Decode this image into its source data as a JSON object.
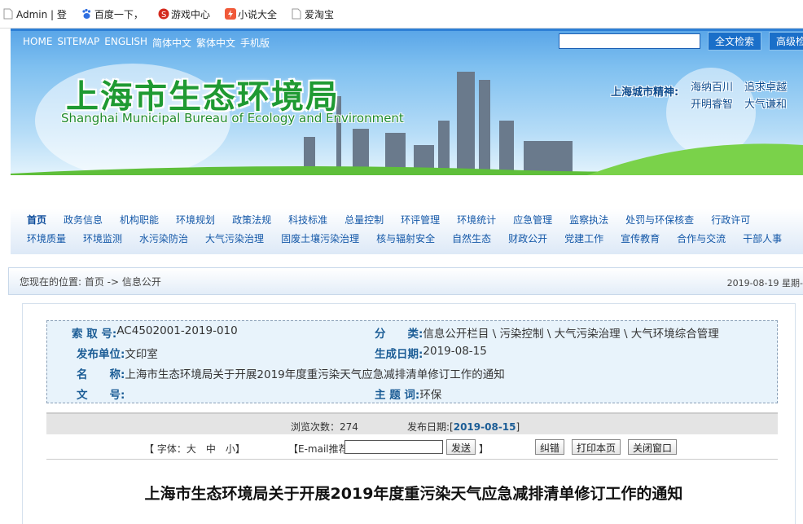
{
  "bookmarks": [
    {
      "label": "Admin | 登",
      "icon": "page-icon"
    },
    {
      "label": "百度一下，",
      "icon": "baidu-paw-icon"
    },
    {
      "label": "游戏中心",
      "icon": "game-icon"
    },
    {
      "label": "小说大全",
      "icon": "novel-icon"
    },
    {
      "label": "爱淘宝",
      "icon": "page-icon"
    }
  ],
  "header": {
    "topnav": [
      "HOME",
      "SITEMAP",
      "ENGLISH",
      "简体中文",
      "繁体中文",
      "手机版"
    ],
    "search_placeholder": "",
    "search_button": "全文检索",
    "advanced_button": "高级检",
    "title_cn": "上海市生态环境局",
    "title_en": "Shanghai Municipal Bureau of Ecology and Environment",
    "spirit_label": "上海城市精神:",
    "motto": [
      "海纳百川",
      "追求卓越",
      "开明睿智",
      "大气谦和"
    ]
  },
  "nav": {
    "row1": [
      "首页",
      "政务信息",
      "机构职能",
      "环境规划",
      "政策法规",
      "科技标准",
      "总量控制",
      "环评管理",
      "环境统计",
      "应急管理",
      "监察执法",
      "处罚与环保核查",
      "行政许可"
    ],
    "row2": [
      "环境质量",
      "环境监测",
      "水污染防治",
      "大气污染治理",
      "固废土壤污染治理",
      "核与辐射安全",
      "自然生态",
      "财政公开",
      "党建工作",
      "宣传教育",
      "合作与交流",
      "干部人事"
    ]
  },
  "breadcrumb": {
    "text": "您现在的位置: 首页 -> 信息公开",
    "date": "2019-08-19 星期-"
  },
  "meta": {
    "index_label": "索 取 号:",
    "index_value": "AC4502001-2019-010",
    "category_label": "分　　类:",
    "category_value": "信息公开栏目 \\ 污染控制 \\ 大气污染治理 \\ 大气环境综合管理",
    "publisher_label": "发布单位:",
    "publisher_value": "文印室",
    "gen_date_label": "生成日期:",
    "gen_date_value": "2019-08-15",
    "name_label": "名　　称:",
    "name_value": "上海市生态环境局关于开展2019年度重污染天气应急减排清单修订工作的通知",
    "docno_label": "文　　号:",
    "docno_value": "",
    "subject_label": "主 题 词:",
    "subject_value": "环保"
  },
  "stats": {
    "views_label": "浏览次数：274",
    "pub_label": "发布日期:[",
    "pub_date": "2019-08-15",
    "pub_end": "]"
  },
  "tools": {
    "font_label": "【 字体：大　中　小】",
    "email_label": "【E-mail推荐",
    "send": "发送",
    "email_end": "】",
    "correct": "纠错",
    "print": "打印本页",
    "close": "关闭窗口"
  },
  "article": {
    "title": "上海市生态环境局关于开展2019年度重污染天气应急减排清单修订工作的通知"
  }
}
